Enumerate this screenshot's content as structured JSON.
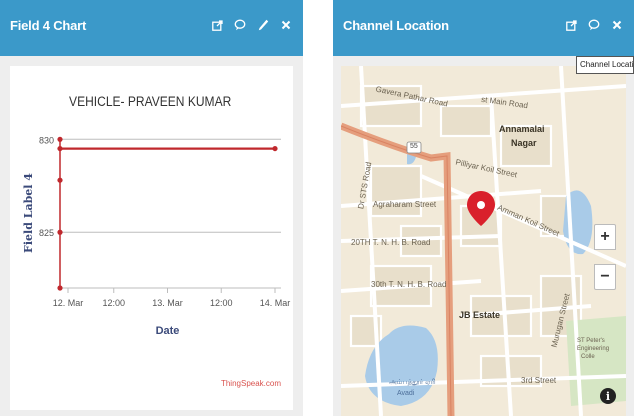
{
  "widgets": [
    {
      "title": "Field 4 Chart",
      "icons": [
        "external-link-icon",
        "comment-icon",
        "pencil-icon",
        "close-icon"
      ]
    },
    {
      "title": "Channel Location",
      "icons": [
        "external-link-icon",
        "comment-icon",
        "close-icon"
      ]
    }
  ],
  "chart_data": {
    "type": "line",
    "title": "VEHICLE- PRAVEEN KUMAR",
    "xlabel": "Date",
    "ylabel": "Field Label 4",
    "x_ticks": [
      "12. Mar",
      "12:00",
      "13. Mar",
      "12:00",
      "14. Mar"
    ],
    "y_ticks": [
      830,
      825
    ],
    "ylim": [
      822,
      830.5
    ],
    "grid": true,
    "series": [
      {
        "color": "#c0282d",
        "points": [
          {
            "x": "12. Mar 00:00",
            "y": 830
          },
          {
            "x": "12. Mar 00:00",
            "y": 829.5
          },
          {
            "x": "12. Mar 00:00",
            "y": 827.8
          },
          {
            "x": "12. Mar 00:00",
            "y": 825
          },
          {
            "x": "12. Mar 00:00",
            "y": 822
          },
          {
            "x": "14. Mar 00:00",
            "y": 829.5
          }
        ]
      }
    ],
    "watermark": "ThingSpeak.com"
  },
  "map": {
    "labels": {
      "gavera": "Gavera Pathar Road",
      "main_road": "st Main Road",
      "annamalai": "Annamalai",
      "nagar": "Nagar",
      "pilliyar": "Pilliyar Koil Street",
      "agraharam": "Agraharam Street",
      "road_20th": "20TH T. N. H. B. Road",
      "road_30th": "30th T. N. H. B. Road",
      "dr_sts": "Dr STS Road",
      "amman_koil": "Amman Koil Street",
      "jb_estate": "JB Estate",
      "murugan": "Murugan Street",
      "third_street": "3rd Street",
      "st_peters": "ST Peter's",
      "engineering": "Engineering",
      "college": "Colle",
      "highway": "55",
      "lake": "அம்பத்தூர் ஏரி",
      "lake2": "Avadi"
    },
    "zoom_in": "+",
    "zoom_out": "−",
    "info": "i",
    "tooltip": "Channel Location"
  }
}
